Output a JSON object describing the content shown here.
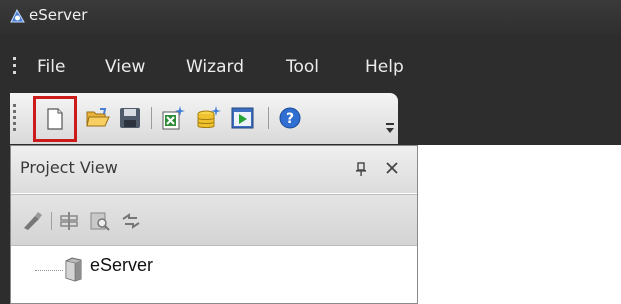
{
  "window": {
    "title": "eServer",
    "icon": "eserver-app-icon"
  },
  "menu": {
    "items": [
      "File",
      "View",
      "Wizard",
      "Tool",
      "Help"
    ]
  },
  "toolbar": {
    "buttons": [
      {
        "name": "new-document-icon"
      },
      {
        "name": "open-folder-icon"
      },
      {
        "name": "save-icon"
      },
      {
        "name": "new-excel-icon"
      },
      {
        "name": "new-database-icon"
      },
      {
        "name": "run-icon"
      },
      {
        "name": "help-icon"
      }
    ],
    "highlight_color": "#cc1b1b"
  },
  "project_view": {
    "title": "Project View",
    "tools": [
      "disconnect-icon",
      "layout-icon",
      "search-icon",
      "refresh-link-icon"
    ],
    "tree": [
      {
        "label": "eServer",
        "icon": "server-icon"
      }
    ]
  }
}
